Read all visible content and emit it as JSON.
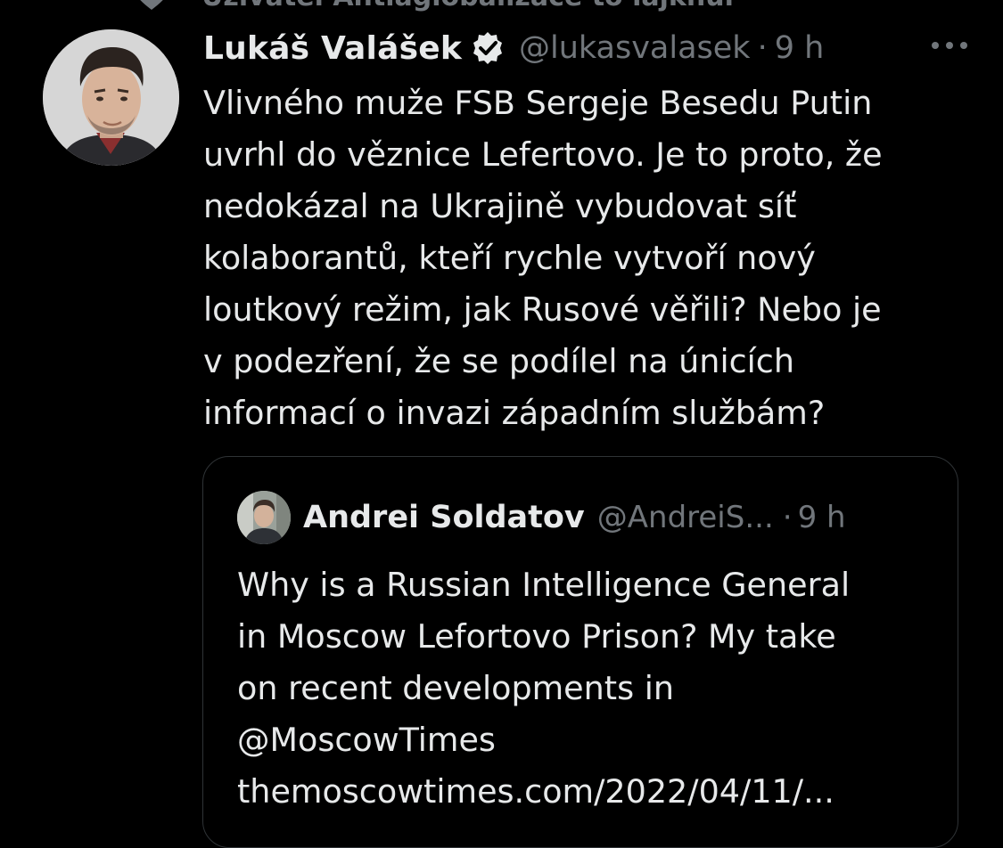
{
  "context": {
    "text": "Uživatel Antiaglobalizace to lajknul"
  },
  "tweet": {
    "author_name": "Lukáš Valášek",
    "handle": "@lukasvalasek",
    "separator": "·",
    "time": "9 h",
    "text_lines": [
      "Vlivného muže FSB Sergeje Besedu Putin",
      "uvrhl do věznice Lefertovo. Je to proto, že",
      "nedokázal na Ukrajině vybudovat síť",
      "kolaborantů, kteří rychle vytvoří nový",
      "loutkový režim, jak Rusové věřili? Nebo je",
      "v podezření, že se podílel na únicích",
      "informací o invazi západním službám?"
    ]
  },
  "quoted_tweet": {
    "author_name": "Andrei Soldatov",
    "handle": "@AndreiS...",
    "separator": "·",
    "time": "9 h",
    "text_lines": [
      "Why is a Russian Intelligence General",
      "in Moscow Lefortovo Prison? My take",
      "on recent developments in",
      "@MoscowTimes",
      "themoscowtimes.com/2022/04/11/..."
    ]
  },
  "icons": {
    "context": "heart-icon",
    "verified": "verified-badge-icon",
    "more": "more-options-icon",
    "avatar": "avatar",
    "quote_avatar": "quote-avatar"
  },
  "colors": {
    "background": "#000000",
    "text_primary": "#e7e9ea",
    "text_secondary": "#71767b",
    "border": "#2f3336"
  }
}
